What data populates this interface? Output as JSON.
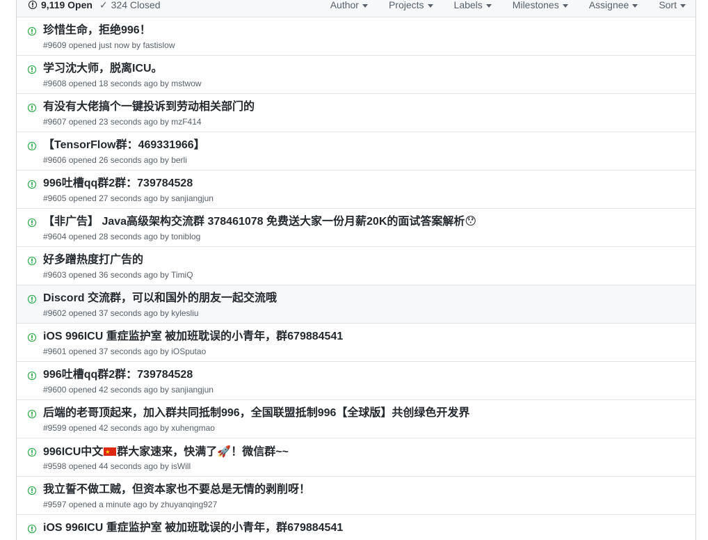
{
  "header": {
    "open_count": "9,119 Open",
    "closed_count": "324 Closed",
    "filters": [
      "Author",
      "Projects",
      "Labels",
      "Milestones",
      "Assignee",
      "Sort"
    ]
  },
  "issues": [
    {
      "title": "珍惜生命，拒绝996！",
      "number": "#9609",
      "time": "opened just now",
      "author": "fastislow"
    },
    {
      "title": "学习沈大师，脱离ICU。",
      "number": "#9608",
      "time": "opened 18 seconds ago",
      "author": "mstwow"
    },
    {
      "title": "有没有大佬搞个一键投诉到劳动相关部门的",
      "number": "#9607",
      "time": "opened 23 seconds ago",
      "author": "mzF414"
    },
    {
      "title": "【TensorFlow群：469331966】",
      "number": "#9606",
      "time": "opened 26 seconds ago",
      "author": "berli"
    },
    {
      "title": "996吐槽qq群2群：739784528",
      "number": "#9605",
      "time": "opened 27 seconds ago",
      "author": "sanjiangjun"
    },
    {
      "title": "【非广告】 Java高级架构交流群 378461078 免费送大家一份月薪20K的面试答案解析😯",
      "number": "#9604",
      "time": "opened 28 seconds ago",
      "author": "toniblog"
    },
    {
      "title": "好多蹭热度打广告的",
      "number": "#9603",
      "time": "opened 36 seconds ago",
      "author": "TimiQ"
    },
    {
      "title": "Discord 交流群，可以和国外的朋友一起交流哦",
      "number": "#9602",
      "time": "opened 37 seconds ago",
      "author": "kylesliu"
    },
    {
      "title": "iOS 996ICU 重症监护室 被加班耽误的小青年，群679884541",
      "number": "#9601",
      "time": "opened 37 seconds ago",
      "author": "iOSputao"
    },
    {
      "title": "996吐槽qq群2群：739784528",
      "number": "#9600",
      "time": "opened 42 seconds ago",
      "author": "sanjiangjun"
    },
    {
      "title": "后端的老哥顶起来，加入群共同抵制996，全国联盟抵制996【全球版】共创绿色开发界",
      "number": "#9599",
      "time": "opened 42 seconds ago",
      "author": "xuhengmao"
    },
    {
      "title_parts": [
        "996ICU中文",
        "群大家速来，快满了",
        "🚀",
        "！微信群~~"
      ],
      "number": "#9598",
      "time": "opened 44 seconds ago",
      "author": "isWill"
    },
    {
      "title": "我立誓不做工贼，但资本家也不要总是无情的剥削呀！",
      "number": "#9597",
      "time": "opened a minute ago",
      "author": "zhuyanqing927"
    },
    {
      "title": "iOS 996ICU 重症监护室 被加班耽误的小青年，群679884541",
      "number": "",
      "time": "",
      "author": ""
    }
  ],
  "by_word": "by",
  "colors": {
    "open_icon": "#28a745",
    "title": "#24292e",
    "meta": "#586069",
    "border": "#e1e4e8",
    "hover_row": "#f6f8fa"
  }
}
